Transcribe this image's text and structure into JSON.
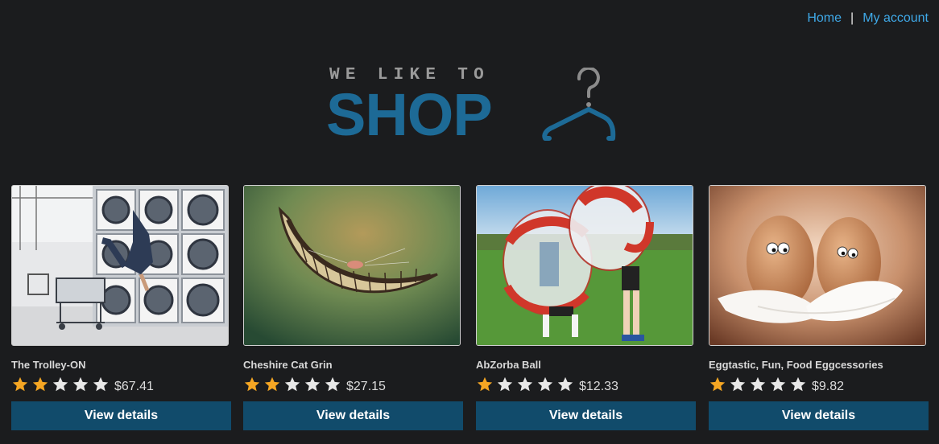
{
  "nav": {
    "home_label": "Home",
    "separator": "|",
    "account_label": "My account"
  },
  "logo": {
    "tagline": "WE LIKE TO",
    "brand": "SHOP",
    "icon": "hanger-icon",
    "brand_color": "#1d6a96"
  },
  "products": [
    {
      "title": "The Trolley-ON",
      "rating": 2,
      "max_rating": 5,
      "price": "$67.41",
      "button_label": "View details",
      "image": "laundromat-trolley-photo"
    },
    {
      "title": "Cheshire Cat Grin",
      "rating": 2,
      "max_rating": 5,
      "price": "$27.15",
      "button_label": "View details",
      "image": "cheshire-grin-photo"
    },
    {
      "title": "AbZorba Ball",
      "rating": 1,
      "max_rating": 5,
      "price": "$12.33",
      "button_label": "View details",
      "image": "bubble-ball-photo"
    },
    {
      "title": "Eggtastic, Fun, Food Eggcessories",
      "rating": 1,
      "max_rating": 5,
      "price": "$9.82",
      "button_label": "View details",
      "image": "eggs-on-feathers-photo"
    }
  ],
  "colors": {
    "background": "#1b1c1e",
    "link": "#3fa9e8",
    "button": "#114b6b",
    "star_filled": "#f5a623",
    "star_empty": "#e8e8e8"
  }
}
